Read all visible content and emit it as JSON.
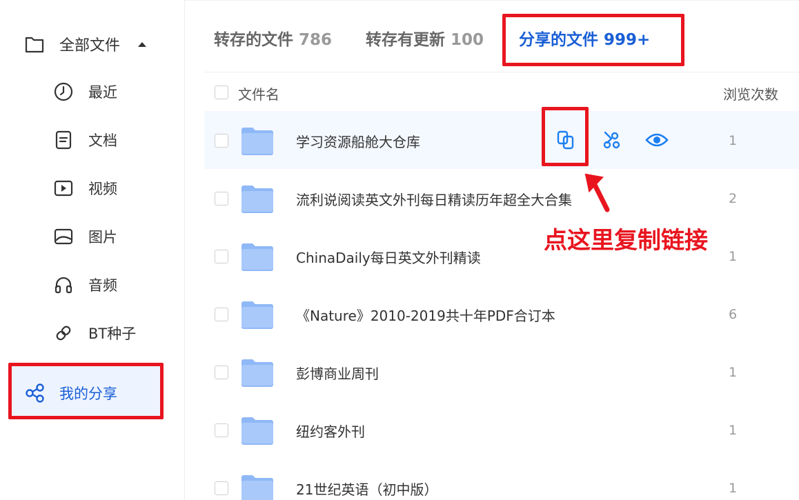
{
  "sidebar": {
    "root": {
      "label": "全部文件",
      "icon": "folder-icon"
    },
    "items": [
      {
        "label": "最近",
        "icon": "clock-icon"
      },
      {
        "label": "文档",
        "icon": "document-icon"
      },
      {
        "label": "视频",
        "icon": "video-icon"
      },
      {
        "label": "图片",
        "icon": "image-icon"
      },
      {
        "label": "音频",
        "icon": "headphones-icon"
      },
      {
        "label": "BT种子",
        "icon": "link-icon"
      }
    ],
    "share": {
      "label": "我的分享",
      "icon": "share-icon",
      "active": true
    }
  },
  "tabs": [
    {
      "label": "转存的文件",
      "count": "786",
      "active": false
    },
    {
      "label": "转存有更新",
      "count": "100",
      "active": false
    },
    {
      "label": "分享的文件",
      "count": "999+",
      "active": true
    }
  ],
  "table": {
    "headers": {
      "name": "文件名",
      "views": "浏览次数"
    },
    "rows": [
      {
        "name": "学习资源船舱大仓库",
        "views": "1",
        "hovered": true
      },
      {
        "name": "流利说阅读英文外刊每日精读历年超全大合集",
        "views": "2"
      },
      {
        "name": "ChinaDaily每日英文外刊精读",
        "views": "1"
      },
      {
        "name": "《Nature》2010-2019共十年PDF合订本",
        "views": "6"
      },
      {
        "name": "彭博商业周刊",
        "views": "1"
      },
      {
        "name": "纽约客外刊",
        "views": "1"
      },
      {
        "name": "21世纪英语（初中版）",
        "views": "1"
      }
    ],
    "row_actions": [
      {
        "icon": "copy-link-icon"
      },
      {
        "icon": "cancel-share-icon"
      },
      {
        "icon": "eye-icon"
      }
    ]
  },
  "annotation": {
    "text": "点这里复制链接"
  },
  "colors": {
    "accent": "#1a5fd6",
    "highlight": "#e8151f",
    "folder": "#8fb8f6",
    "hover_row": "#f4f8ff"
  }
}
